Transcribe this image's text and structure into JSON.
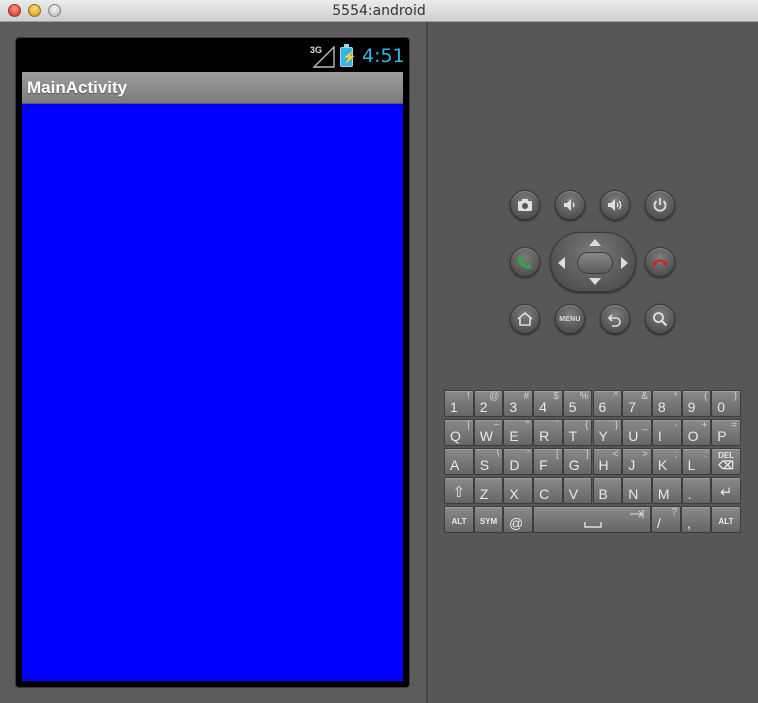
{
  "window": {
    "title": "5554:android"
  },
  "status_bar": {
    "network": "3G",
    "time": "4:51"
  },
  "action_bar": {
    "title": "MainActivity"
  },
  "colors": {
    "content_background": "#0000ff",
    "accent": "#33b5e5"
  },
  "hardware_buttons": {
    "menu_label": "MENU"
  },
  "keyboard": {
    "row1": [
      {
        "main": "1",
        "alt": "!"
      },
      {
        "main": "2",
        "alt": "@"
      },
      {
        "main": "3",
        "alt": "#"
      },
      {
        "main": "4",
        "alt": "$"
      },
      {
        "main": "5",
        "alt": "%"
      },
      {
        "main": "6",
        "alt": "^"
      },
      {
        "main": "7",
        "alt": "&"
      },
      {
        "main": "8",
        "alt": "*"
      },
      {
        "main": "9",
        "alt": "("
      },
      {
        "main": "0",
        "alt": ")"
      }
    ],
    "row2": [
      {
        "main": "Q",
        "alt": "|"
      },
      {
        "main": "W",
        "alt": "~"
      },
      {
        "main": "E",
        "alt": "\""
      },
      {
        "main": "R",
        "alt": "`"
      },
      {
        "main": "T",
        "alt": "{"
      },
      {
        "main": "Y",
        "alt": "}"
      },
      {
        "main": "U",
        "alt": "_"
      },
      {
        "main": "I",
        "alt": "-"
      },
      {
        "main": "O",
        "alt": "+"
      },
      {
        "main": "P",
        "alt": "="
      }
    ],
    "row3": [
      {
        "main": "A",
        "alt": ""
      },
      {
        "main": "S",
        "alt": "\\"
      },
      {
        "main": "D",
        "alt": "'"
      },
      {
        "main": "F",
        "alt": "["
      },
      {
        "main": "G",
        "alt": "]"
      },
      {
        "main": "H",
        "alt": "<"
      },
      {
        "main": "J",
        "alt": ">"
      },
      {
        "main": "K",
        "alt": ";"
      },
      {
        "main": "L",
        "alt": ":"
      },
      {
        "main": "DEL",
        "alt": ""
      }
    ],
    "row4": [
      {
        "main": "⇧",
        "alt": ""
      },
      {
        "main": "Z",
        "alt": ""
      },
      {
        "main": "X",
        "alt": ""
      },
      {
        "main": "C",
        "alt": ""
      },
      {
        "main": "V",
        "alt": ""
      },
      {
        "main": "B",
        "alt": ""
      },
      {
        "main": "N",
        "alt": ""
      },
      {
        "main": "M",
        "alt": ""
      },
      {
        "main": ".",
        "alt": ""
      },
      {
        "main": "↵",
        "alt": ""
      }
    ],
    "row5": {
      "alt_left": "ALT",
      "sym": "SYM",
      "at": "@",
      "slash": "/",
      "question": "?",
      "comma": ",",
      "alt_right": "ALT"
    }
  }
}
